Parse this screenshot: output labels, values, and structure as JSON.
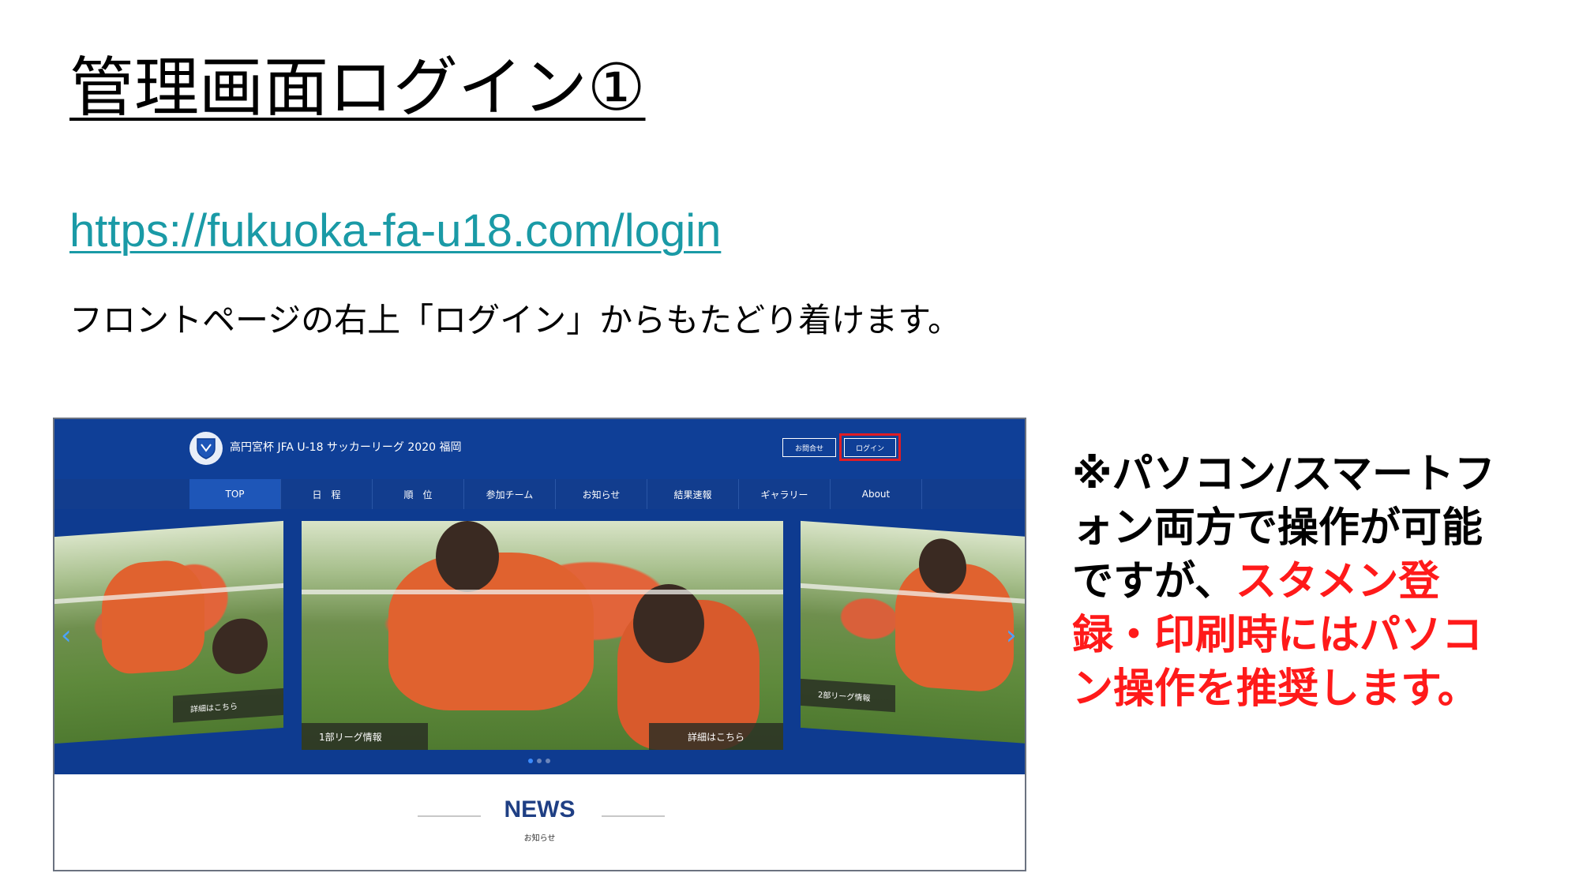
{
  "slide": {
    "title": "管理画面ログイン①",
    "url": "https://fukuoka-fa-u18.com/login",
    "subtext": "フロントページの右上「ログイン」からもたどり着けます。",
    "note_black": "※パソコン/スマートフォン両方で操作が可能ですが、",
    "note_red": "スタメン登録・印刷時にはパソコン操作を推奨します。"
  },
  "site": {
    "name": "高円宮杯 JFA U-18 サッカーリーグ 2020 福岡",
    "contact_label": "お問合せ",
    "login_label": "ログイン",
    "nav": [
      "TOP",
      "日　程",
      "順　位",
      "参加チーム",
      "お知らせ",
      "結果速報",
      "ギャラリー",
      "About"
    ],
    "slides": {
      "left_caption": "詳細はこちら",
      "center_caption_left": "1部リーグ情報",
      "center_caption_right": "詳細はこちら",
      "right_caption": "2部リーグ情報"
    },
    "news_title": "NEWS",
    "news_sub": "お知らせ"
  },
  "colors": {
    "header_blue": "#0f3f97",
    "highlight_red": "#e01c24",
    "url_teal": "#1a9aa6",
    "note_red": "#ff1a1a"
  },
  "icons": [
    "shield-logo-icon",
    "chevron-left-icon",
    "chevron-right-icon"
  ]
}
